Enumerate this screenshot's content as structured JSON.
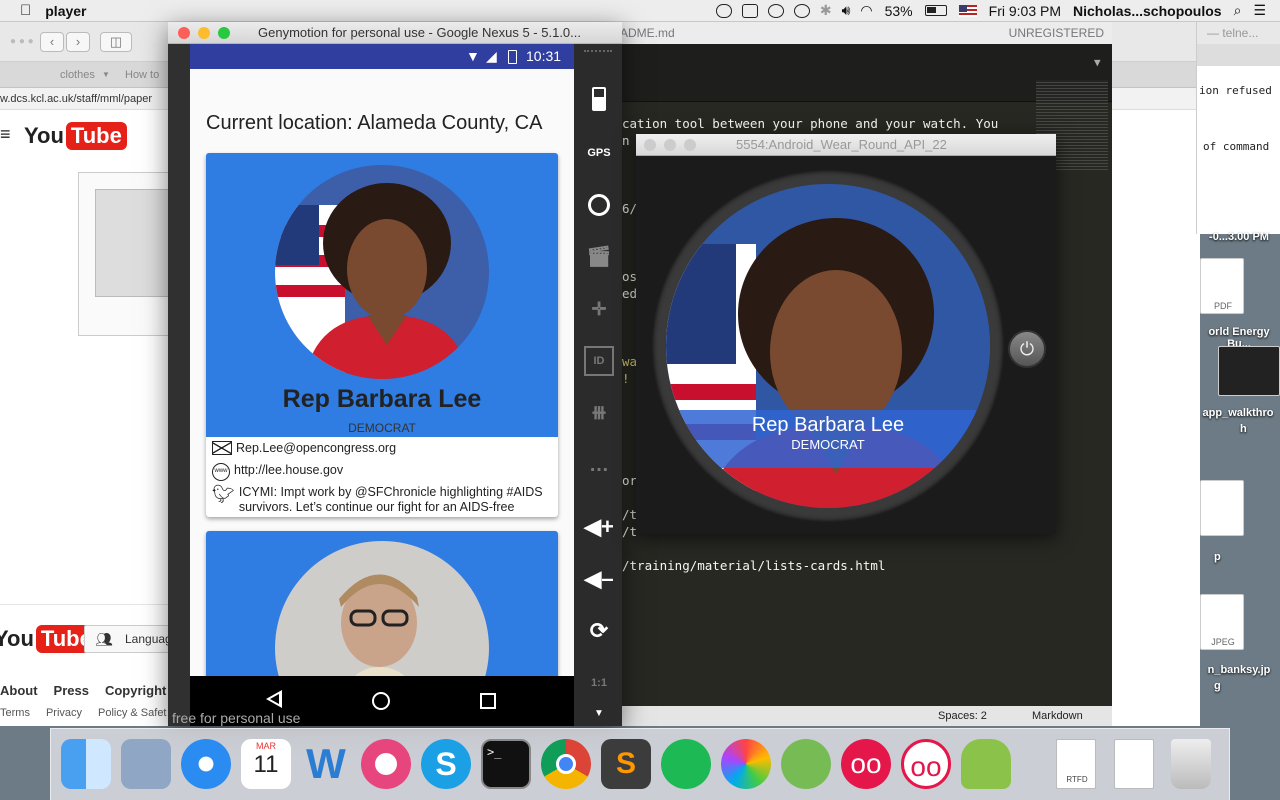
{
  "menubar": {
    "app_name": "player",
    "battery": "53%",
    "time": "Fri 9:03 PM",
    "user": "Nicholas...schopoulos"
  },
  "browser": {
    "tab1": "clothes",
    "tab2": "How to",
    "url": "w.dcs.kcl.ac.uk/staff/mml/paper",
    "yt_you": "You",
    "yt_tube": "Tube",
    "language_button": "Languag",
    "footer_links": [
      "About",
      "Press",
      "Copyright"
    ],
    "footer_small": [
      "Terms",
      "Privacy",
      "Policy & Safet"
    ]
  },
  "editor": {
    "file_title": "ADME.md",
    "unregistered": "UNREGISTERED",
    "lines": [
      {
        "t": "cation tool between your phone and your watch. You",
        "c": "#f8f8f2"
      },
      {
        "t": "n",
        "c": "#f8f8f2"
      },
      {
        "t": "6/",
        "c": "#f8f8f2"
      },
      {
        "t": "os",
        "c": "#f8f8f2"
      },
      {
        "t": "ed",
        "c": "#f8f8f2"
      },
      {
        "t": "wa",
        "c": "#e6db74"
      },
      {
        "t": "! ",
        "c": "#e6db74"
      },
      {
        "t": "or",
        "c": "#f8f8f2"
      },
      {
        "t": "/t",
        "c": "#f8f8f2"
      },
      {
        "t": "/t",
        "c": "#f8f8f2"
      },
      {
        "t": "/training/material/lists-cards.html",
        "c": "#f8f8f2"
      }
    ],
    "spaces": "Spaces: 2",
    "syntax": "Markdown"
  },
  "terminal": {
    "title": "— telne...",
    "line1": "ion refused",
    "line2": "of command"
  },
  "desktop": {
    "screenshot_label": "-0...3.00 PM",
    "pdf_badge": "PDF",
    "file1": "orld Energy Bu...",
    "file2": "app_walkthro",
    "file2b": "h",
    "file3": "p",
    "jpeg_badge": "JPEG",
    "file4": "n_banksy.jp",
    "file4b": "g"
  },
  "genymotion": {
    "title": "Genymotion for personal use - Google Nexus 5 - 5.1.0...",
    "free_label": "free for personal use",
    "tool_labels": {
      "gps": "GPS",
      "id": "ID",
      "ratio": "1:1"
    }
  },
  "phone": {
    "clock": "10:31",
    "current_location": "Current location: Alameda County, CA",
    "cards": [
      {
        "name": "Rep Barbara Lee",
        "party": "DEMOCRAT",
        "email": "Rep.Lee@opencongress.org",
        "website": "http://lee.house.gov",
        "tweet": "ICYMI: Impt work by @SFChronicle highlighting #AIDS survivors. Let’s continue our fight for an AIDS-free"
      },
      {
        "name": "",
        "party": ""
      }
    ]
  },
  "wear": {
    "title": "5554:Android_Wear_Round_API_22",
    "name": "Rep Barbara Lee",
    "party": "DEMOCRAT"
  },
  "dock": {
    "calendar_month": "MAR",
    "calendar_day": "11",
    "textedit_label": "RTFD"
  },
  "colors": {
    "card_blue": "#2f7ce3",
    "status_bar": "#303f9f",
    "editor_bg": "#272822"
  }
}
